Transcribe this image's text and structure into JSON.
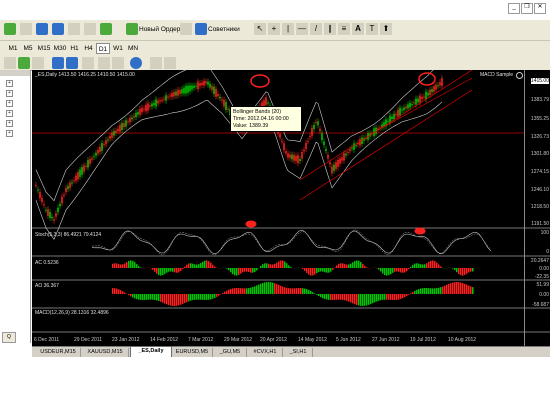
{
  "toolbar": {
    "new_order_label": "Новый Ордер",
    "advisors_label": "Советники"
  },
  "periods": [
    "M1",
    "M5",
    "M15",
    "M30",
    "H1",
    "H4",
    "D1",
    "W1",
    "MN"
  ],
  "active_period": "D1",
  "chart": {
    "title": "_ES,Daily  1413.50  1416.25  1410.50  1415.00",
    "indicator_label": "MACD Sample",
    "price_labels": [
      "1415.00",
      "1383.79",
      "1355.25",
      "1326.73",
      "1301.80",
      "1274.15",
      "1246.10",
      "1218.50",
      "1191.50"
    ],
    "stoch_label": "Stoch(5,3,3) 86.4921 79.4124",
    "stoch_axis": [
      "100",
      "0"
    ],
    "ac_label": "AC 0.5236",
    "ac_axis": [
      "20.2647",
      "0.00",
      "-22.35"
    ],
    "ao_label": "AO 36.367",
    "ao_axis": [
      "51.99",
      "0.00",
      "-58.687"
    ],
    "macd_label": "MACD(12,26,9) 28.1316 32.4896",
    "date_labels": [
      "6 Dec 2011",
      "29 Dec 2011",
      "23 Jan 2012",
      "14 Feb 2012",
      "7 Mar 2012",
      "29 Mar 2012",
      "20 Apr 2012",
      "14 May 2012",
      "5 Jun 2012",
      "27 Jun 2012",
      "19 Jul 2012",
      "10 Aug 2012"
    ],
    "tooltip": {
      "line1": "Bollinger Bands (20)",
      "line2": "Time: 2012.04.16 00:00",
      "line3": "Value: 1389.39"
    }
  },
  "tabs": [
    "USDEUR,M15",
    "XAUUSD,M15",
    "_ES,Daily",
    "EURUSD,M5",
    "_GU,M5",
    "#CVX,H1",
    "_SI,H1"
  ],
  "active_tab": "_ES,Daily",
  "colors": {
    "bull": "#00c800",
    "bear": "#ff2020",
    "band": "#d0d0d0",
    "channel": "#e00000"
  }
}
